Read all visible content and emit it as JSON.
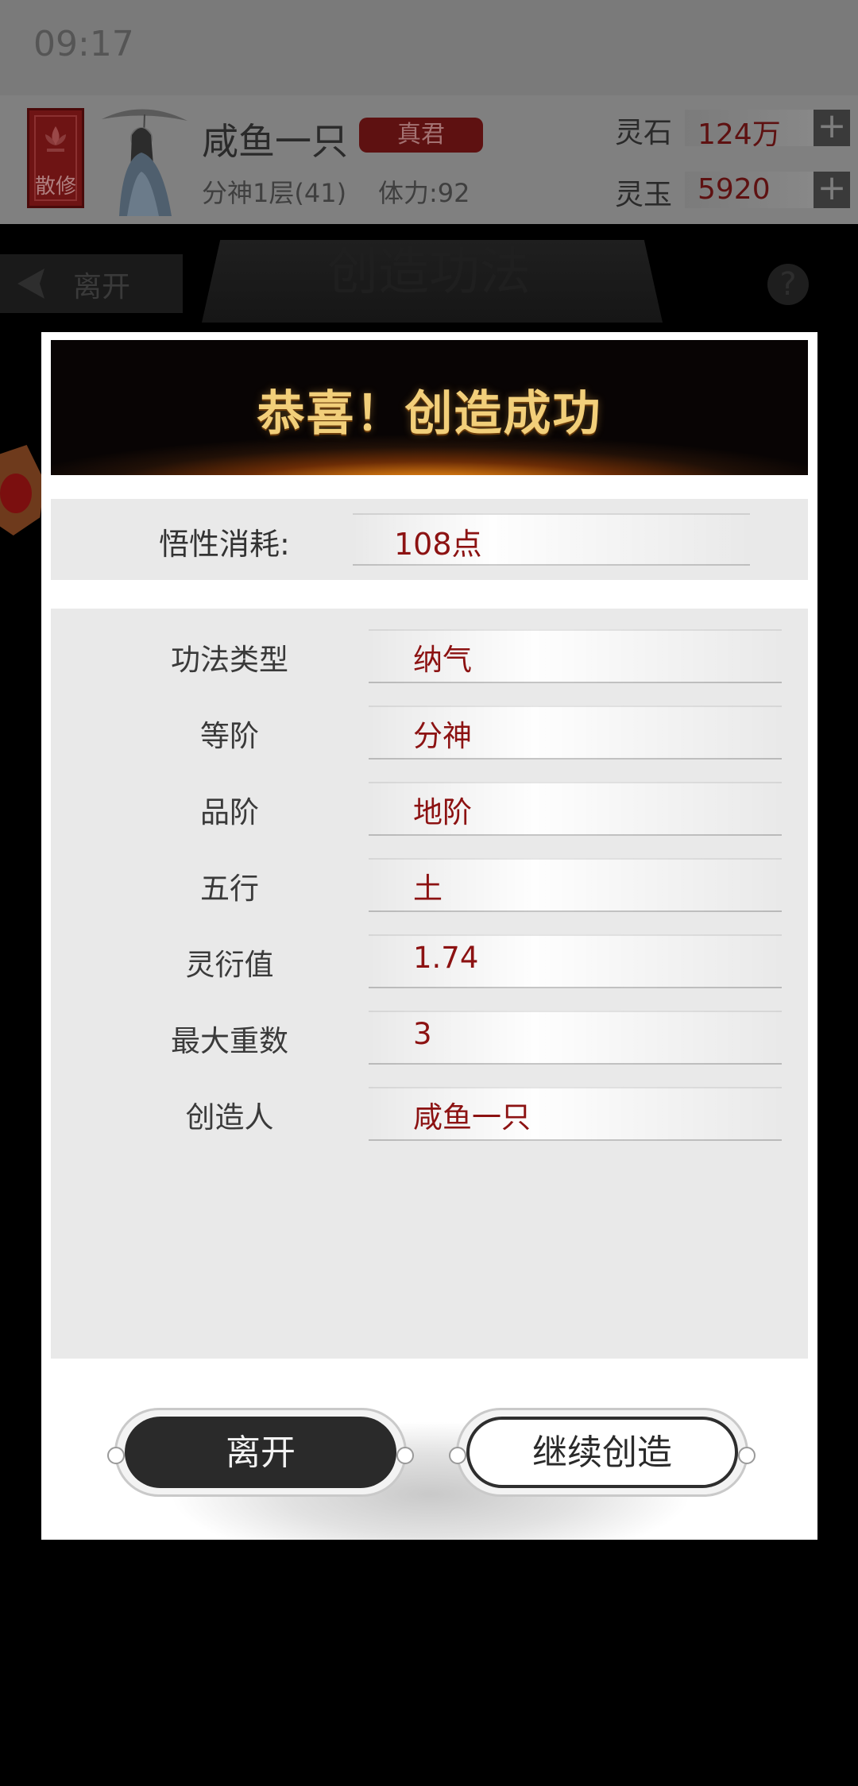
{
  "status_bar": {
    "time": "09:17"
  },
  "player": {
    "sect_label": "散修",
    "name": "咸鱼一只",
    "rank": "真君",
    "realm": "分神1层(41)",
    "stamina": "体力:92"
  },
  "resources": [
    {
      "label": "灵石",
      "value": "124万"
    },
    {
      "label": "灵玉",
      "value": "5920"
    }
  ],
  "page_header": {
    "back_label": "离开",
    "title": "创造功法",
    "help_symbol": "?"
  },
  "modal": {
    "banner_title": "恭喜！创造成功",
    "cost": {
      "label": "悟性消耗:",
      "value": "108点"
    },
    "rows": [
      {
        "label": "功法类型",
        "value": "纳气"
      },
      {
        "label": "等阶",
        "value": "分神"
      },
      {
        "label": "品阶",
        "value": "地阶"
      },
      {
        "label": "五行",
        "value": "土"
      },
      {
        "label": "灵衍值",
        "value": "1.74"
      },
      {
        "label": "最大重数",
        "value": "3"
      },
      {
        "label": "创造人",
        "value": "咸鱼一只"
      }
    ],
    "buttons": {
      "leave": "离开",
      "continue": "继续创造"
    }
  },
  "colors": {
    "accent_red": "#8c1212",
    "banner_gold": "#f2cf7a",
    "panel_gray": "#e9e9e9"
  }
}
